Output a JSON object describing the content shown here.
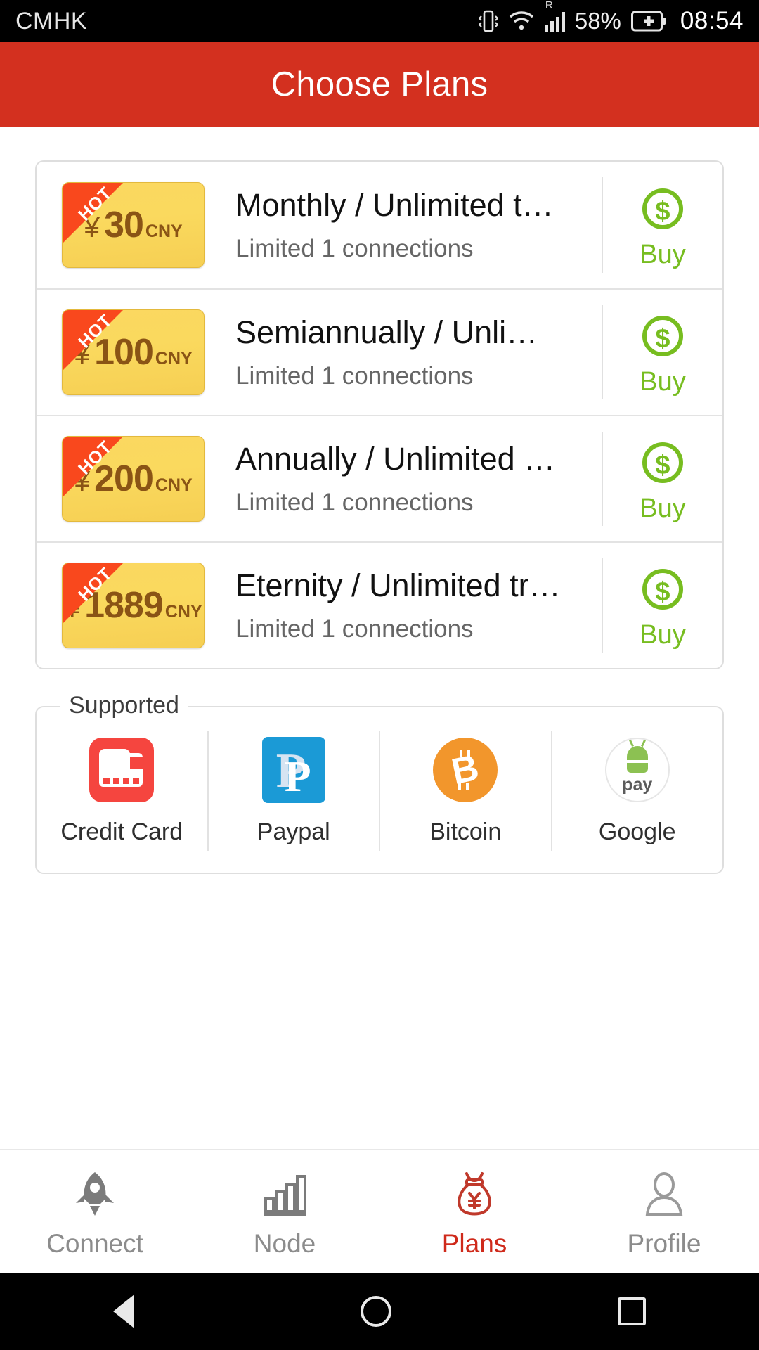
{
  "statusbar": {
    "carrier": "CMHK",
    "battery_percent": "58%",
    "clock": "08:54",
    "roaming_indicator": "R",
    "icons": [
      "vibrate-icon",
      "wifi-icon",
      "signal-icon",
      "battery-charging-icon"
    ]
  },
  "header": {
    "title": "Choose Plans",
    "background_color": "#d3301f"
  },
  "plans": [
    {
      "badge": "HOT",
      "currency_symbol": "¥",
      "amount": "30",
      "currency_code": "CNY",
      "title": "Monthly / Unlimited t…",
      "subtitle": "Limited 1 connections",
      "action_label": "Buy"
    },
    {
      "badge": "HOT",
      "currency_symbol": "¥",
      "amount": "100",
      "currency_code": "CNY",
      "title": "Semiannually / Unli…",
      "subtitle": "Limited 1 connections",
      "action_label": "Buy"
    },
    {
      "badge": "HOT",
      "currency_symbol": "¥",
      "amount": "200",
      "currency_code": "CNY",
      "title": "Annually / Unlimited …",
      "subtitle": "Limited 1 connections",
      "action_label": "Buy"
    },
    {
      "badge": "HOT",
      "currency_symbol": "¥",
      "amount": "1889",
      "currency_code": "CNY",
      "title": "Eternity / Unlimited tr…",
      "subtitle": "Limited 1 connections",
      "action_label": "Buy"
    }
  ],
  "supported": {
    "legend": "Supported",
    "methods": [
      {
        "label": "Credit Card",
        "icon": "credit-card-icon"
      },
      {
        "label": "Paypal",
        "icon": "paypal-icon"
      },
      {
        "label": "Bitcoin",
        "icon": "bitcoin-icon"
      },
      {
        "label": "Google",
        "icon": "google-pay-icon"
      }
    ]
  },
  "bottom_nav": {
    "items": [
      {
        "label": "Connect",
        "icon": "rocket-icon",
        "active": false
      },
      {
        "label": "Node",
        "icon": "bar-chart-icon",
        "active": false
      },
      {
        "label": "Plans",
        "icon": "money-bag-icon",
        "active": true
      },
      {
        "label": "Profile",
        "icon": "person-icon",
        "active": false
      }
    ],
    "active_color": "#cf2a1b",
    "inactive_color": "#8c8c8c"
  },
  "android_nav": {
    "buttons": [
      "back-button",
      "home-button",
      "recents-button"
    ]
  },
  "colors": {
    "accent_green": "#77bd20",
    "header_red": "#d3301f",
    "ticket_gold": "#fad95e",
    "hot_orange": "#f9481d"
  }
}
